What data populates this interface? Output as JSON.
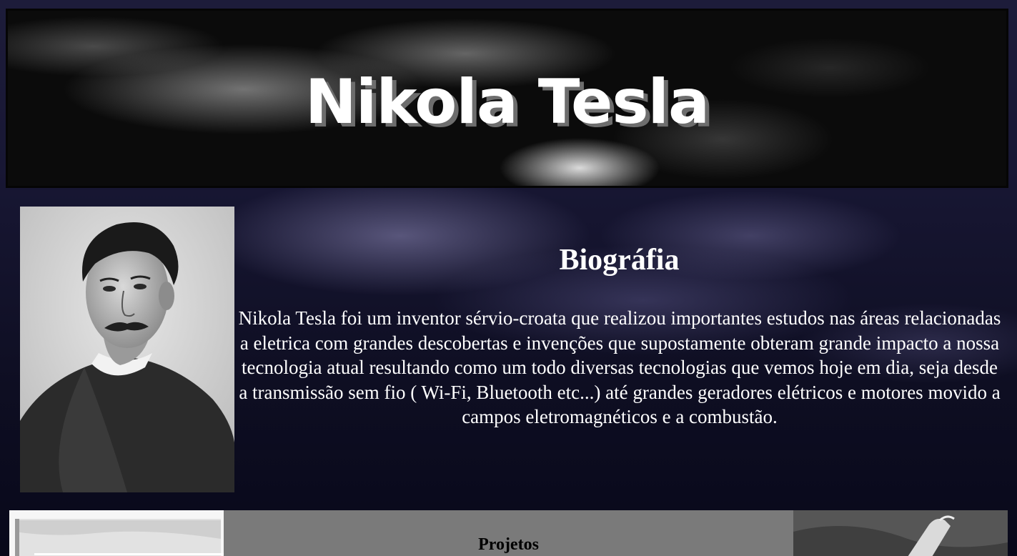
{
  "header": {
    "title": "Nikola Tesla"
  },
  "biography": {
    "heading": "Biográfia",
    "text": "Nikola Tesla foi um inventor sérvio-croata que realizou importantes estudos nas áreas relacionadas a eletrica com grandes descobertas e invenções que supostamente obteram grande impacto a nossa tecnologia atual resultando como um todo diversas tecnologias que vemos hoje em dia, seja desde a transmissão sem fio ( Wi-Fi, Bluetooth etc...) até grandes geradores elétricos e motores movido a campos eletromagnéticos e a combustão."
  },
  "projects": {
    "heading": "Projetos"
  },
  "colors": {
    "background": "#10112a",
    "projects_panel": "#7a7a7a",
    "text": "#ffffff"
  }
}
